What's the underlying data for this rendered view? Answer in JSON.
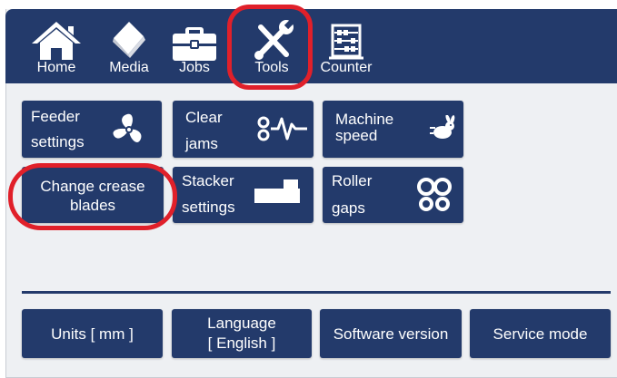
{
  "nav": [
    {
      "label": "Home",
      "icon": "home-icon"
    },
    {
      "label": "Media",
      "icon": "media-icon"
    },
    {
      "label": "Jobs",
      "icon": "briefcase-icon"
    },
    {
      "label": "Tools",
      "icon": "tools-icon"
    },
    {
      "label": "Counter",
      "icon": "abacus-icon"
    }
  ],
  "tiles": {
    "feeder": {
      "line1": "Feeder",
      "line2": "settings",
      "icon": "fan-icon"
    },
    "clear_jams": {
      "line1": "Clear",
      "line2": "jams",
      "icon": "jam-icon"
    },
    "machine_speed": {
      "line1": "Machine",
      "line2": "speed",
      "icon": "rabbit-icon"
    },
    "change_crease": {
      "line1": "Change crease",
      "line2": "blades"
    },
    "stacker": {
      "line1": "Stacker",
      "line2": "settings",
      "icon": "stacker-icon"
    },
    "roller_gaps": {
      "line1": "Roller",
      "line2": "gaps",
      "icon": "rollers-icon"
    }
  },
  "bottom": {
    "units": "Units  [ mm ]",
    "language_line1": "Language",
    "language_line2": "[ English ]",
    "software": "Software version",
    "service": "Service mode"
  },
  "colors": {
    "panel": "#233a6b",
    "background": "#eef0f3",
    "highlight": "#e0202a"
  }
}
